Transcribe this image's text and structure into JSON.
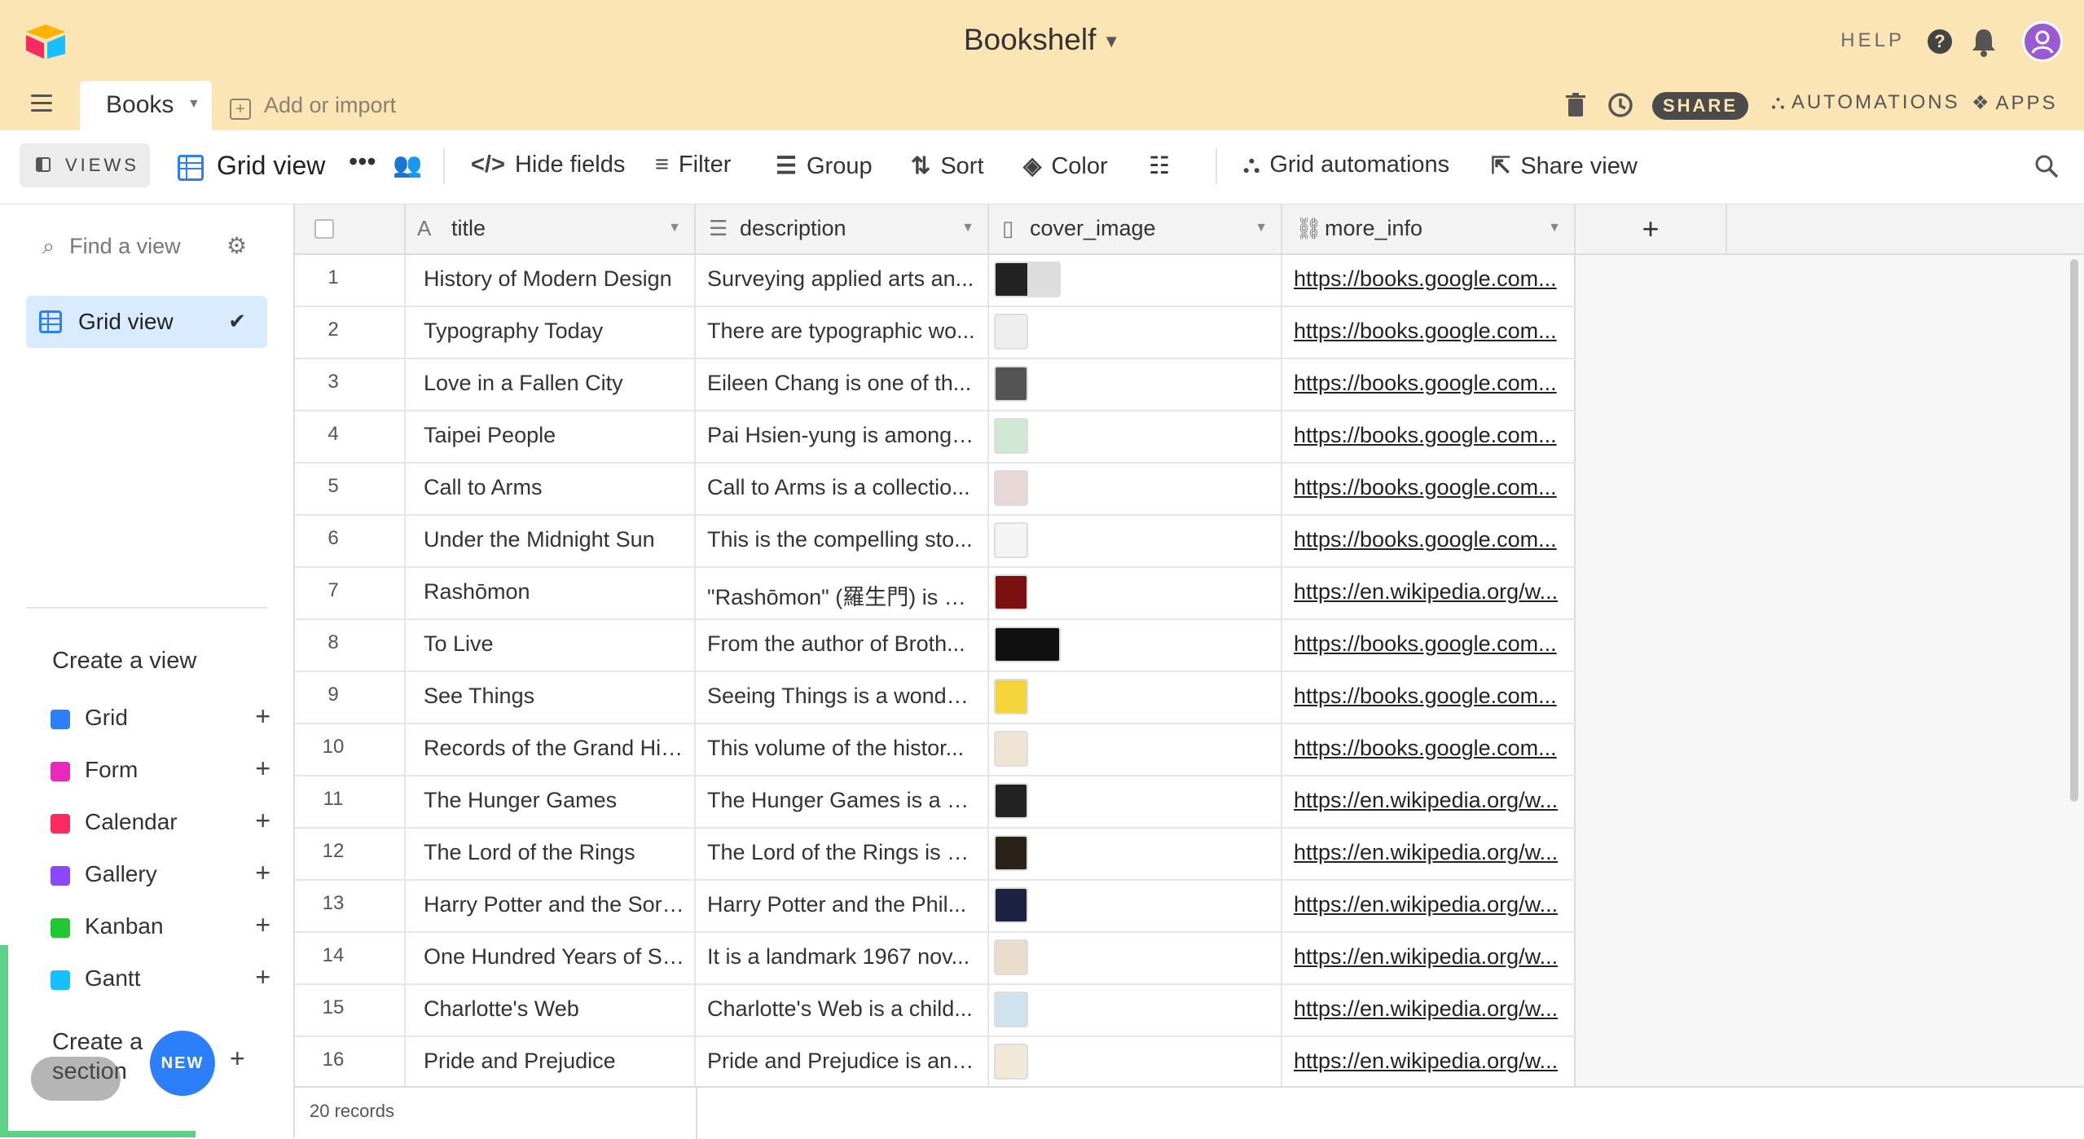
{
  "header": {
    "base_name": "Bookshelf",
    "help_label": "HELP",
    "tab_label": "Books",
    "add_import_label": "Add or import",
    "share_label": "SHARE",
    "automations_label": "AUTOMATIONS",
    "apps_label": "APPS"
  },
  "toolbar": {
    "views_label": "VIEWS",
    "view_name": "Grid view",
    "hide_fields": "Hide fields",
    "filter": "Filter",
    "group": "Group",
    "sort": "Sort",
    "color": "Color",
    "grid_automations": "Grid automations",
    "share_view": "Share view"
  },
  "sidebar": {
    "find_placeholder": "Find a view",
    "active_view": "Grid view",
    "create_view_heading": "Create a view",
    "view_types": [
      {
        "label": "Grid",
        "color": "#2d7ff9"
      },
      {
        "label": "Form",
        "color": "#e929ba"
      },
      {
        "label": "Calendar",
        "color": "#f82b60"
      },
      {
        "label": "Gallery",
        "color": "#8b46ff"
      },
      {
        "label": "Kanban",
        "color": "#20c933"
      },
      {
        "label": "Gantt",
        "color": "#18bfff"
      }
    ],
    "create_section_line1": "Create a",
    "create_section_line2": "section",
    "new_badge": "NEW"
  },
  "grid": {
    "columns": [
      "title",
      "description",
      "cover_image",
      "more_info"
    ],
    "rows": [
      {
        "n": "1",
        "title": "History of Modern Design",
        "description": "Surveying applied arts an...",
        "link": "https://books.google.com..."
      },
      {
        "n": "2",
        "title": "Typography Today",
        "description": "There are typographic wo...",
        "link": "https://books.google.com..."
      },
      {
        "n": "3",
        "title": "Love in a Fallen City",
        "description": "Eileen Chang is one of th...",
        "link": "https://books.google.com..."
      },
      {
        "n": "4",
        "title": "Taipei People",
        "description": "Pai Hsien-yung is among ...",
        "link": "https://books.google.com..."
      },
      {
        "n": "5",
        "title": "Call to Arms",
        "description": "Call to Arms is a collectio...",
        "link": "https://books.google.com..."
      },
      {
        "n": "6",
        "title": "Under the Midnight Sun",
        "description": "This is the compelling sto...",
        "link": "https://books.google.com..."
      },
      {
        "n": "7",
        "title": "Rashōmon",
        "description": "\"Rashōmon\" (羅生門) is a ...",
        "link": "https://en.wikipedia.org/w..."
      },
      {
        "n": "8",
        "title": "To Live",
        "description": "From the author of Broth...",
        "link": "https://books.google.com..."
      },
      {
        "n": "9",
        "title": "See Things",
        "description": "Seeing Things is a wonde...",
        "link": "https://books.google.com..."
      },
      {
        "n": "10",
        "title": "Records of the Grand His...",
        "description": "This volume of the histor...",
        "link": "https://books.google.com..."
      },
      {
        "n": "11",
        "title": "The Hunger Games",
        "description": "The Hunger Games is a s...",
        "link": "https://en.wikipedia.org/w..."
      },
      {
        "n": "12",
        "title": "The Lord of the Rings",
        "description": "The Lord of the Rings is a...",
        "link": "https://en.wikipedia.org/w..."
      },
      {
        "n": "13",
        "title": "Harry Potter and the Sorc...",
        "description": "Harry Potter and the Phil...",
        "link": "https://en.wikipedia.org/w..."
      },
      {
        "n": "14",
        "title": "One Hundred Years of Sol...",
        "description": "It is a landmark 1967 nov...",
        "link": "https://en.wikipedia.org/w..."
      },
      {
        "n": "15",
        "title": "Charlotte's Web",
        "description": "Charlotte's Web is a child...",
        "link": "https://en.wikipedia.org/w..."
      },
      {
        "n": "16",
        "title": "Pride and Prejudice",
        "description": "Pride and Prejudice is an ...",
        "link": "https://en.wikipedia.org/w..."
      }
    ],
    "record_count": "20 records"
  },
  "colors": {
    "header_bg": "#fbe5b4",
    "accent_blue": "#2d7ff9",
    "avatar": "#9a5ad2"
  }
}
